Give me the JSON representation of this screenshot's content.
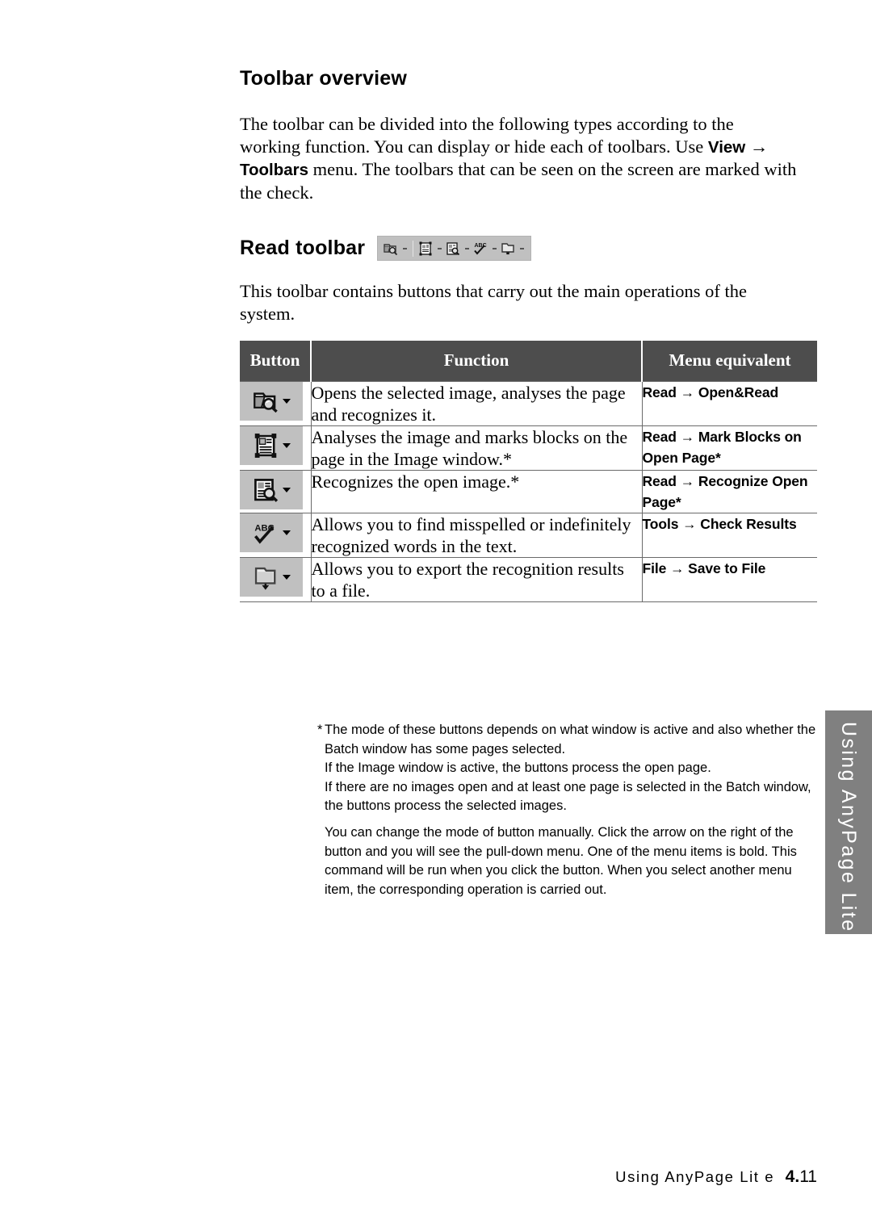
{
  "section": {
    "title": "Toolbar overview",
    "intro_parts": [
      {
        "t": "The toolbar can be divided into the following types according to the working function. You can display or hide each of toolbars. Use ",
        "b": false
      },
      {
        "t": "View",
        "b": true
      },
      {
        "t": " → ",
        "b": false
      },
      {
        "t": "Toolbars",
        "b": true
      },
      {
        "t": " menu. The toolbars that can be seen on the screen are marked with the check.",
        "b": false
      }
    ],
    "intro_plain": "The toolbar can be divided into the following types according to the working function. You can display or hide each of toolbars. Use View → Toolbars menu. The toolbars that can be seen on the screen are marked with the check."
  },
  "read_toolbar": {
    "heading": "Read toolbar",
    "description": "This toolbar contains buttons that carry out the main operations of the system.",
    "strip_buttons": [
      {
        "icon": "open-and-read-icon",
        "caret": "dropdown-arrow-icon"
      },
      {
        "icon": "mark-blocks-icon",
        "caret": "dropdown-arrow-icon"
      },
      {
        "icon": "recognize-icon",
        "caret": "dropdown-arrow-icon"
      },
      {
        "icon": "check-spelling-icon",
        "caret": "dropdown-arrow-icon"
      },
      {
        "icon": "save-to-file-icon",
        "caret": "dropdown-arrow-icon"
      }
    ]
  },
  "table": {
    "headers": [
      "Button",
      "Function",
      "Menu equivalent"
    ],
    "rows": [
      {
        "icon": "open-and-read-icon",
        "function": "Opens the selected image, analyses the page and recognizes it.",
        "menu": "Read → Open&Read"
      },
      {
        "icon": "mark-blocks-icon",
        "function": "Analyses the image and marks blocks on the page in the Image window.*",
        "menu": "Read → Mark Blocks on Open Page*"
      },
      {
        "icon": "recognize-icon",
        "function": "Recognizes the open image.*",
        "menu": "Read → Recognize Open Page*"
      },
      {
        "icon": "check-spelling-icon",
        "function": "Allows you to find misspelled or indefinitely recognized words in the text.",
        "menu": "Tools → Check Results"
      },
      {
        "icon": "save-to-file-icon",
        "function": "Allows you to export the recognition results to a file.",
        "menu": "File → Save to File"
      }
    ]
  },
  "footnotes": {
    "star": "*",
    "note1_lines": [
      "The mode of these buttons depends on what window is active and also whether the",
      "Batch window has some pages selected.",
      "If the Image window is active, the buttons process the open page.",
      "If there are no images open and at least one page is selected in the Batch window,",
      "the buttons process the selected images."
    ],
    "note2_lines": [
      "You can change the mode of button manually. Click the arrow on the right of the",
      "button and you will see the pull-down menu. One of the menu items is bold. This",
      "command will be run when you click the button. When you select another menu",
      "item, the corresponding operation is carried out."
    ]
  },
  "side_tab": {
    "label": "Using AnyPage Lite"
  },
  "footer": {
    "title": "Using AnyPage Lit e",
    "page_bold": "4.",
    "page_rest": "11"
  },
  "colors": {
    "table_header_bg": "#4d4d4d",
    "button_swatch_bg": "#c0c0c0",
    "side_tab_bg": "#808080",
    "rule": "#6a6a6a"
  }
}
